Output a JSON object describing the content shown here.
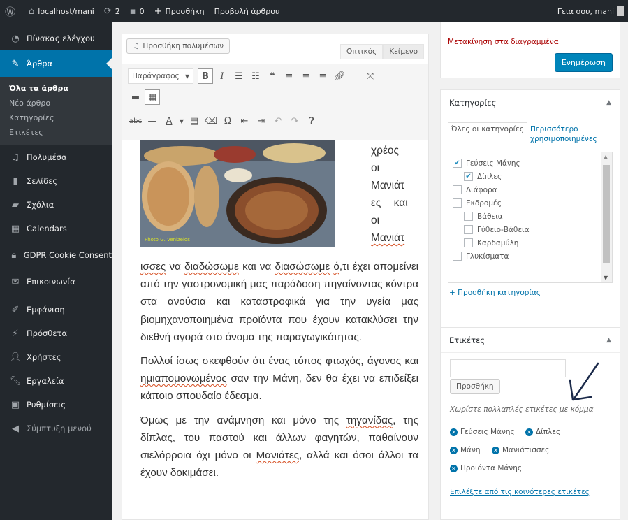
{
  "admin_bar": {
    "site": "localhost/mani",
    "updates": "2",
    "comments": "0",
    "new": "Προσθήκη",
    "view_post": "Προβολή άρθρου",
    "greeting": "Γεια σου, mani"
  },
  "sidebar": {
    "dashboard": "Πίνακας ελέγχου",
    "posts": "Άρθρα",
    "posts_sub": [
      "Όλα τα άρθρα",
      "Νέο άρθρο",
      "Κατηγορίες",
      "Ετικέτες"
    ],
    "media": "Πολυμέσα",
    "pages": "Σελίδες",
    "comments": "Σχόλια",
    "calendars": "Calendars",
    "gdpr": "GDPR Cookie Consent",
    "contact": "Επικοινωνία",
    "appearance": "Εμφάνιση",
    "plugins": "Πρόσθετα",
    "users": "Χρήστες",
    "tools": "Εργαλεία",
    "settings": "Ρυθμίσεις",
    "collapse": "Σύμπτυξη μενού"
  },
  "editor": {
    "add_media": "Προσθήκη πολυμέσων",
    "tab_visual": "Οπτικός",
    "tab_text": "Κείμενο",
    "format": "Παράγραφος",
    "image_caption": "Photo G. Venizelos",
    "right_words": [
      "χρέος",
      "οι",
      "Μανιάτ",
      "ες και",
      "οι",
      "Μανιάτ"
    ],
    "p1_a": "ισσες",
    "p1_b": " να ",
    "p1_c": "διαδώσωμε",
    "p1_d": " και να ",
    "p1_e": "διασώσωμε",
    "p1_f": " ",
    "p1_g": "ό",
    "p1_h": ",τι έχει απομείνει από την γαστρονομική μας παράδοση πηγαίνοντας κόντρα στα ανούσια και καταστροφικά για την υγεία μας βιομηχανοποιημένα προϊόντα που έχουν κατακλύσει την διεθνή αγορά στο όνομα της παραγωγικότητας.",
    "p2_a": "Πολλοί ίσως σκεφθούν ότι ένας τόπος φτωχός, άγονος και ",
    "p2_b": "ημιαπομονωμένος",
    "p2_c": " σαν την Μάνη, δεν θα έχει να επιδείξει κάποιο σπουδαίο έδεσμα.",
    "p3_a": "Όμως με την ανάμνηση και μόνο της ",
    "p3_b": "τηγανίδας",
    "p3_c": ", της δίπλας, του παστού και άλλων φαγητών, παθαίνουν σιελόρροια όχι μόνο οι ",
    "p3_d": "Μανιάτες",
    "p3_e": ", αλλά και όσοι άλλοι τα έχουν δοκιμάσει."
  },
  "publish": {
    "move_to_trash": "Μετακίνηση στα διαγραμμένα",
    "update": "Ενημέρωση"
  },
  "categories": {
    "title": "Κατηγορίες",
    "tab_all": "Όλες οι κατηγορίες",
    "tab_popular": "Περισσότερο χρησιμοποιημένες",
    "items": [
      {
        "label": "Γεύσεις Μάνης",
        "checked": "true",
        "level": 0
      },
      {
        "label": "Δίπλες",
        "checked": "true",
        "level": 1
      },
      {
        "label": "Διάφορα",
        "checked": "false",
        "level": 0
      },
      {
        "label": "Εκδρομές",
        "checked": "false",
        "level": 0
      },
      {
        "label": "Βάθεια",
        "checked": "false",
        "level": 1
      },
      {
        "label": "Γύθειο-Βάθεια",
        "checked": "false",
        "level": 1
      },
      {
        "label": "Καρδαμύλη",
        "checked": "false",
        "level": 1
      },
      {
        "label": "Γλυκίσματα",
        "checked": "false",
        "level": 0
      }
    ],
    "add_new": "+ Προσθήκη κατηγορίας"
  },
  "tags": {
    "title": "Ετικέτες",
    "input_value": "",
    "add_button": "Προσθήκη",
    "hint": "Χωρίστε πολλαπλές ετικέτες με κόμμα",
    "chips": [
      "Γεύσεις Μάνης",
      "Δίπλες",
      "Μάνη",
      "Μανιάτισσες",
      "Προϊόντα Μάνης"
    ],
    "choose_popular": "Επιλέξτε από τις κοινότερες ετικέτες"
  }
}
